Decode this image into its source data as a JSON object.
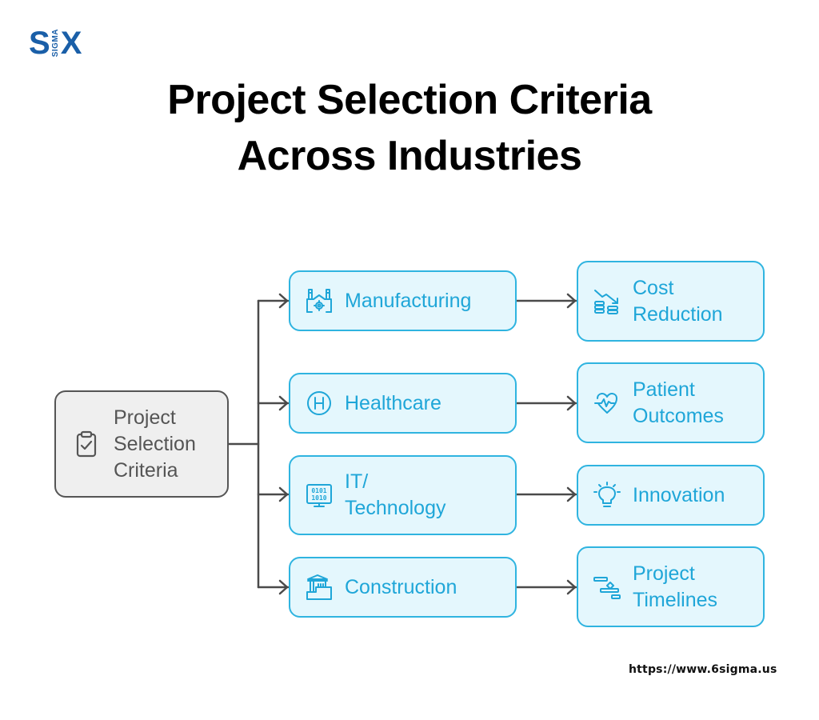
{
  "logo": {
    "left": "S",
    "middle": "SIGMA",
    "right": "X"
  },
  "title": {
    "line1": "Project Selection Criteria",
    "line2": "Across Industries"
  },
  "root": {
    "label_lines": [
      "Project",
      "Selection",
      "Criteria"
    ],
    "icon": "clipboard-check-icon"
  },
  "branches": [
    {
      "industry": {
        "label_lines": [
          "Manufacturing"
        ],
        "icon": "factory-gear-icon"
      },
      "criterion": {
        "label_lines": [
          "Cost",
          "Reduction"
        ],
        "icon": "cost-reduction-icon"
      }
    },
    {
      "industry": {
        "label_lines": [
          "Healthcare"
        ],
        "icon": "hospital-h-icon"
      },
      "criterion": {
        "label_lines": [
          "Patient",
          "Outcomes"
        ],
        "icon": "heart-pulse-icon"
      }
    },
    {
      "industry": {
        "label_lines": [
          "IT/",
          "Technology"
        ],
        "icon": "binary-monitor-icon"
      },
      "criterion": {
        "label_lines": [
          "Innovation"
        ],
        "icon": "lightbulb-icon"
      }
    },
    {
      "industry": {
        "label_lines": [
          "Construction"
        ],
        "icon": "building-construction-icon"
      },
      "criterion": {
        "label_lines": [
          "Project",
          "Timelines"
        ],
        "icon": "gantt-timeline-icon"
      }
    }
  ],
  "colors": {
    "accent": "#2fb4e0",
    "accent_text": "#1fa6d8",
    "accent_fill": "#e4f7fd",
    "root_border": "#555555",
    "root_fill": "#efefef",
    "connector": "#4a4a4a",
    "logo": "#1a5fa8"
  },
  "footer": {
    "url": "https://www.6sigma.us"
  }
}
